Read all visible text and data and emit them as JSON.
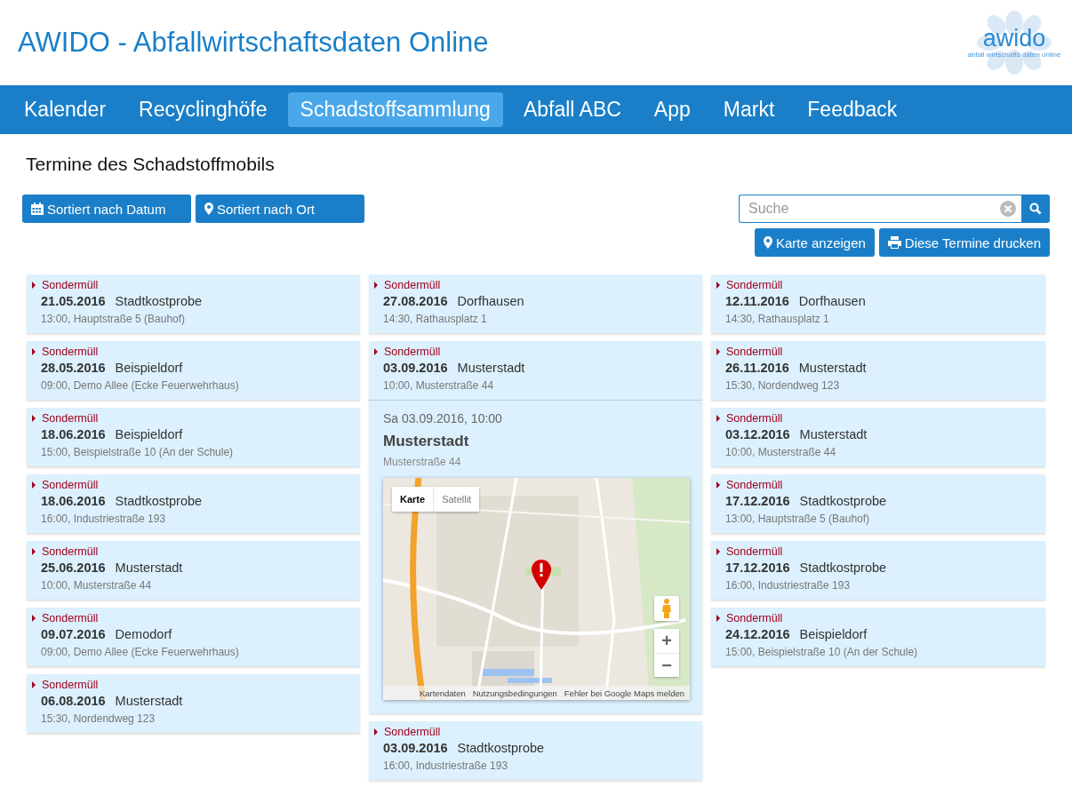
{
  "header": {
    "title": "AWIDO - Abfallwirtschaftsdaten Online",
    "logo": {
      "name": "awido",
      "tagline": "abfall wirtschafts daten online"
    }
  },
  "nav": [
    {
      "label": "Kalender",
      "selected": false
    },
    {
      "label": "Recyclinghöfe",
      "selected": false
    },
    {
      "label": "Schadstoffsammlung",
      "selected": true
    },
    {
      "label": "Abfall ABC",
      "selected": false
    },
    {
      "label": "App",
      "selected": false
    },
    {
      "label": "Markt",
      "selected": false
    },
    {
      "label": "Feedback",
      "selected": false
    }
  ],
  "page_title": "Termine des Schadstoffmobils",
  "sort_buttons": [
    {
      "label": "Sortiert nach Datum",
      "kind": "calendar"
    },
    {
      "label": "Sortiert nach Ort",
      "kind": "pin"
    }
  ],
  "search": {
    "placeholder": "Suche"
  },
  "action_buttons": [
    {
      "label": "Karte anzeigen",
      "kind": "pin"
    },
    {
      "label": "Diese Termine drucken",
      "kind": "print"
    }
  ],
  "columns": [
    {
      "entries": [
        {
          "category": "Sondermüll",
          "date": "21.05.2016",
          "place": "Stadtkostprobe",
          "info": "13:00, Hauptstraße 5 (Bauhof)"
        },
        {
          "category": "Sondermüll",
          "date": "28.05.2016",
          "place": "Beispieldorf",
          "info": "09:00, Demo Allee (Ecke Feuerwehrhaus)"
        },
        {
          "category": "Sondermüll",
          "date": "18.06.2016",
          "place": "Beispieldorf",
          "info": "15:00, Beispielstraße 10 (An der Schule)"
        },
        {
          "category": "Sondermüll",
          "date": "18.06.2016",
          "place": "Stadtkostprobe",
          "info": "16:00, Industriestraße 193"
        },
        {
          "category": "Sondermüll",
          "date": "25.06.2016",
          "place": "Musterstadt",
          "info": "10:00, Musterstraße 44"
        },
        {
          "category": "Sondermüll",
          "date": "09.07.2016",
          "place": "Demodorf",
          "info": "09:00, Demo Allee (Ecke Feuerwehrhaus)"
        },
        {
          "category": "Sondermüll",
          "date": "06.08.2016",
          "place": "Musterstadt",
          "info": "15:30, Nordendweg 123"
        }
      ]
    },
    {
      "entries": [
        {
          "category": "Sondermüll",
          "date": "27.08.2016",
          "place": "Dorfhausen",
          "info": "14:30, Rathausplatz 1"
        },
        {
          "category": "Sondermüll",
          "date": "03.09.2016",
          "place": "Musterstadt",
          "info": "10:00, Musterstraße 44",
          "detail": {
            "datetime": "Sa 03.09.2016, 10:00",
            "place": "Musterstadt",
            "address": "Musterstraße 44",
            "map": {
              "types": [
                {
                  "label": "Karte",
                  "selected": true
                },
                {
                  "label": "Satellit",
                  "selected": false
                }
              ],
              "zoom_in": "+",
              "zoom_out": "−",
              "footer": [
                "Kartendaten",
                "Nutzungsbedingungen",
                "Fehler bei Google Maps melden"
              ]
            }
          }
        },
        {
          "category": "Sondermüll",
          "date": "03.09.2016",
          "place": "Stadtkostprobe",
          "info": "16:00, Industriestraße 193"
        }
      ]
    },
    {
      "entries": [
        {
          "category": "Sondermüll",
          "date": "12.11.2016",
          "place": "Dorfhausen",
          "info": "14:30, Rathausplatz 1"
        },
        {
          "category": "Sondermüll",
          "date": "26.11.2016",
          "place": "Musterstadt",
          "info": "15:30, Nordendweg 123"
        },
        {
          "category": "Sondermüll",
          "date": "03.12.2016",
          "place": "Musterstadt",
          "info": "10:00, Musterstraße 44"
        },
        {
          "category": "Sondermüll",
          "date": "17.12.2016",
          "place": "Stadtkostprobe",
          "info": "13:00, Hauptstraße 5 (Bauhof)"
        },
        {
          "category": "Sondermüll",
          "date": "17.12.2016",
          "place": "Stadtkostprobe",
          "info": "16:00, Industriestraße 193"
        },
        {
          "category": "Sondermüll",
          "date": "24.12.2016",
          "place": "Beispieldorf",
          "info": "15:00, Beispielstraße 10 (An der Schule)"
        }
      ]
    }
  ]
}
